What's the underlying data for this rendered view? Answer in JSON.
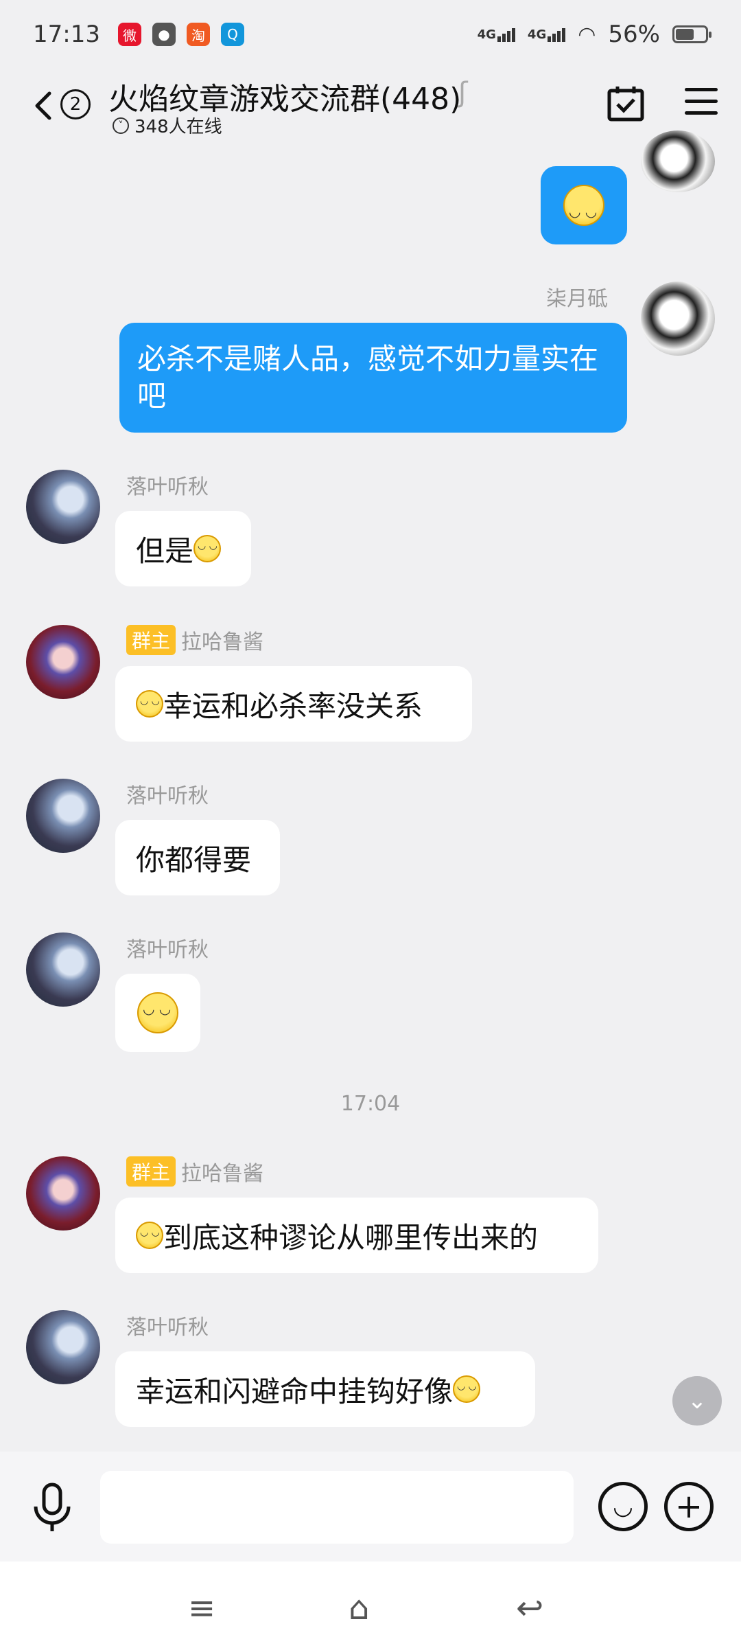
{
  "status": {
    "time": "17:13",
    "net1": "4G",
    "net2": "4G",
    "battery": "56%"
  },
  "header": {
    "back_count": "2",
    "title": "火焰纹章游戏交流群(448)",
    "online": "348人在线"
  },
  "messages": [
    {
      "from": "me",
      "type": "sticker",
      "name": ""
    },
    {
      "from": "me",
      "name": "柒月砥",
      "text": "必杀不是赌人品，感觉不如力量实在吧"
    },
    {
      "from": "other",
      "name": "落叶听秋",
      "text": "但是",
      "emoji": "right"
    },
    {
      "from": "other",
      "role": "群主",
      "name": "拉哈鲁酱",
      "text": "幸运和必杀率没关系",
      "emoji": "left"
    },
    {
      "from": "other",
      "name": "落叶听秋",
      "text": "你都得要"
    },
    {
      "from": "other",
      "name": "落叶听秋",
      "emoji": "only"
    },
    {
      "type": "time",
      "text": "17:04"
    },
    {
      "from": "other",
      "role": "群主",
      "name": "拉哈鲁酱",
      "text": "到底这种谬论从哪里传出来的",
      "emoji": "left"
    },
    {
      "from": "other",
      "name": "落叶听秋",
      "text": "幸运和闪避命中挂钩好像",
      "emoji": "right"
    }
  ],
  "input": {
    "placeholder": ""
  },
  "colors": {
    "my_bubble": "#1e9bf8",
    "owner_tag": "#fcbf26"
  }
}
